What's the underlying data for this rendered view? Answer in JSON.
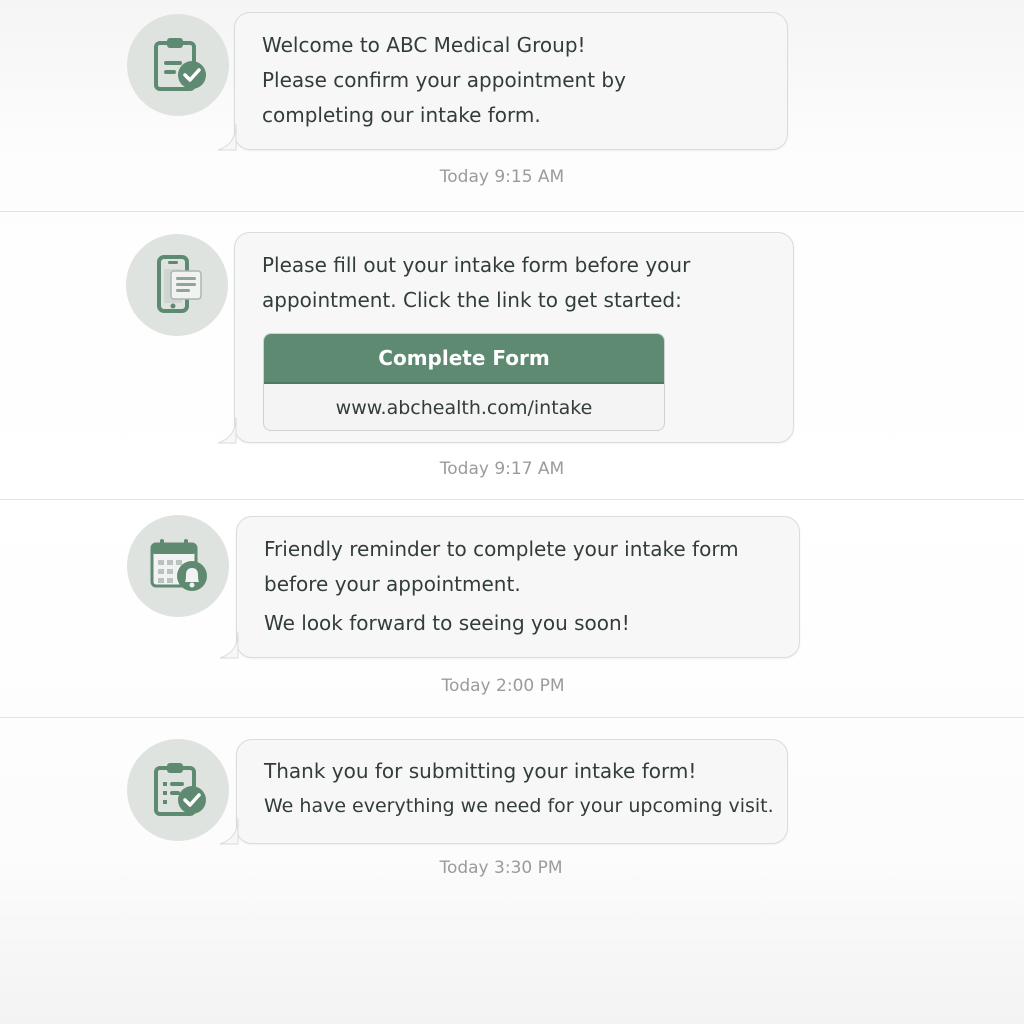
{
  "messages": [
    {
      "icon": "clipboard-check-icon",
      "lines": [
        "Welcome to ABC Medical Group!",
        "Please confirm your appointment by",
        "completing our intake form."
      ],
      "timestamp": "Today 9:15 AM"
    },
    {
      "icon": "phone-form-icon",
      "lines": [
        "Please fill out your intake form before your",
        "appointment. Click the link to get started:"
      ],
      "button_label": "Complete Form",
      "link_text": "www.abchealth.com/intake",
      "timestamp": "Today 9:17 AM"
    },
    {
      "icon": "calendar-bell-icon",
      "lines": [
        "Friendly reminder to complete your intake form",
        "before your appointment.",
        "We look forward to seeing you soon!"
      ],
      "timestamp": "Today 2:00 PM"
    },
    {
      "icon": "clipboard-check-icon",
      "lines": [
        "Thank you for submitting your intake form!",
        "We have everything we need for your upcoming visit."
      ],
      "timestamp": "Today 3:30 PM"
    }
  ],
  "colors": {
    "accent": "#5f8a72",
    "avatar_bg": "#dfe3e0",
    "bubble_bg": "#f7f7f7",
    "text": "#323d39",
    "timestamp": "#9a9c9b"
  }
}
